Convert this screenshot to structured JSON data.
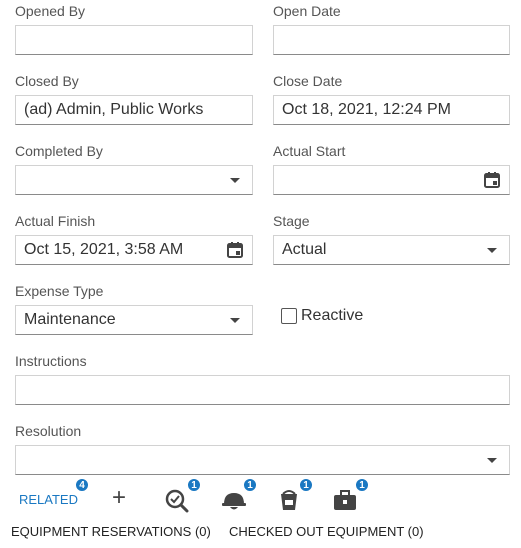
{
  "fields": {
    "opened_by": {
      "label": "Opened By",
      "value": ""
    },
    "open_date": {
      "label": "Open Date",
      "value": ""
    },
    "closed_by": {
      "label": "Closed By",
      "value": "(ad) Admin, Public Works"
    },
    "close_date": {
      "label": "Close Date",
      "value": "Oct 18, 2021, 12:24 PM"
    },
    "completed_by": {
      "label": "Completed By",
      "value": ""
    },
    "actual_start": {
      "label": "Actual Start",
      "value": ""
    },
    "actual_finish": {
      "label": "Actual Finish",
      "value": "Oct 15, 2021, 3:58 AM"
    },
    "stage": {
      "label": "Stage",
      "value": "Actual"
    },
    "expense_type": {
      "label": "Expense Type",
      "value": "Maintenance"
    },
    "reactive": {
      "label": "Reactive",
      "checked": false
    },
    "instructions": {
      "label": "Instructions",
      "value": ""
    },
    "resolution": {
      "label": "Resolution",
      "value": ""
    }
  },
  "toolbar": {
    "related_label": "RELATED",
    "related_count": "4",
    "add_symbol": "+",
    "inspections_count": "1",
    "workers_count": "1",
    "materials_count": "1",
    "equipment_count": "1",
    "icons": [
      "inspection-search-icon",
      "hard-hat-icon",
      "material-bucket-icon",
      "toolbox-icon"
    ],
    "accent_color": "#1a78c2"
  },
  "tabs": [
    {
      "label": "EQUIPMENT RESERVATIONS (0)"
    },
    {
      "label": "CHECKED OUT EQUIPMENT (0)"
    }
  ]
}
